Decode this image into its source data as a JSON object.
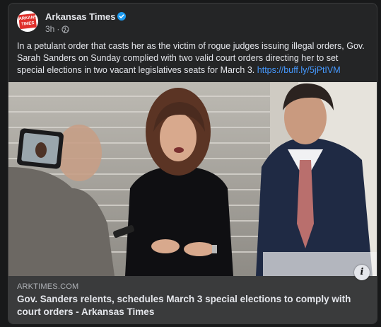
{
  "post": {
    "page_name": "Arkansas Times",
    "time": "3h",
    "time_separator": "·",
    "logo_text_line1": "ARKANSAS",
    "logo_text_line2": "TIMES",
    "text": "In a petulant order that casts her as the victim of rogue judges issuing illegal orders, Gov. Sarah Sanders on Sunday complied with two valid court orders directing her to set special elections in two vacant legislatives seats for March 3.",
    "link_text": "https://buff.ly/5jPtIVM",
    "icons": {
      "verified": "verified-badge-icon",
      "audience": "globe-icon",
      "info": "info-icon"
    }
  },
  "link_preview": {
    "domain": "ARKTIMES.COM",
    "headline": "Gov. Sanders relents, schedules March 3 special elections to comply with court orders - Arkansas Times",
    "info_label": "i"
  },
  "colors": {
    "background": "#18191a",
    "card": "#242526",
    "footer": "#3a3b3c",
    "link": "#4599ff",
    "verified": "#1d9bf0",
    "logo_red": "#e0312c"
  }
}
